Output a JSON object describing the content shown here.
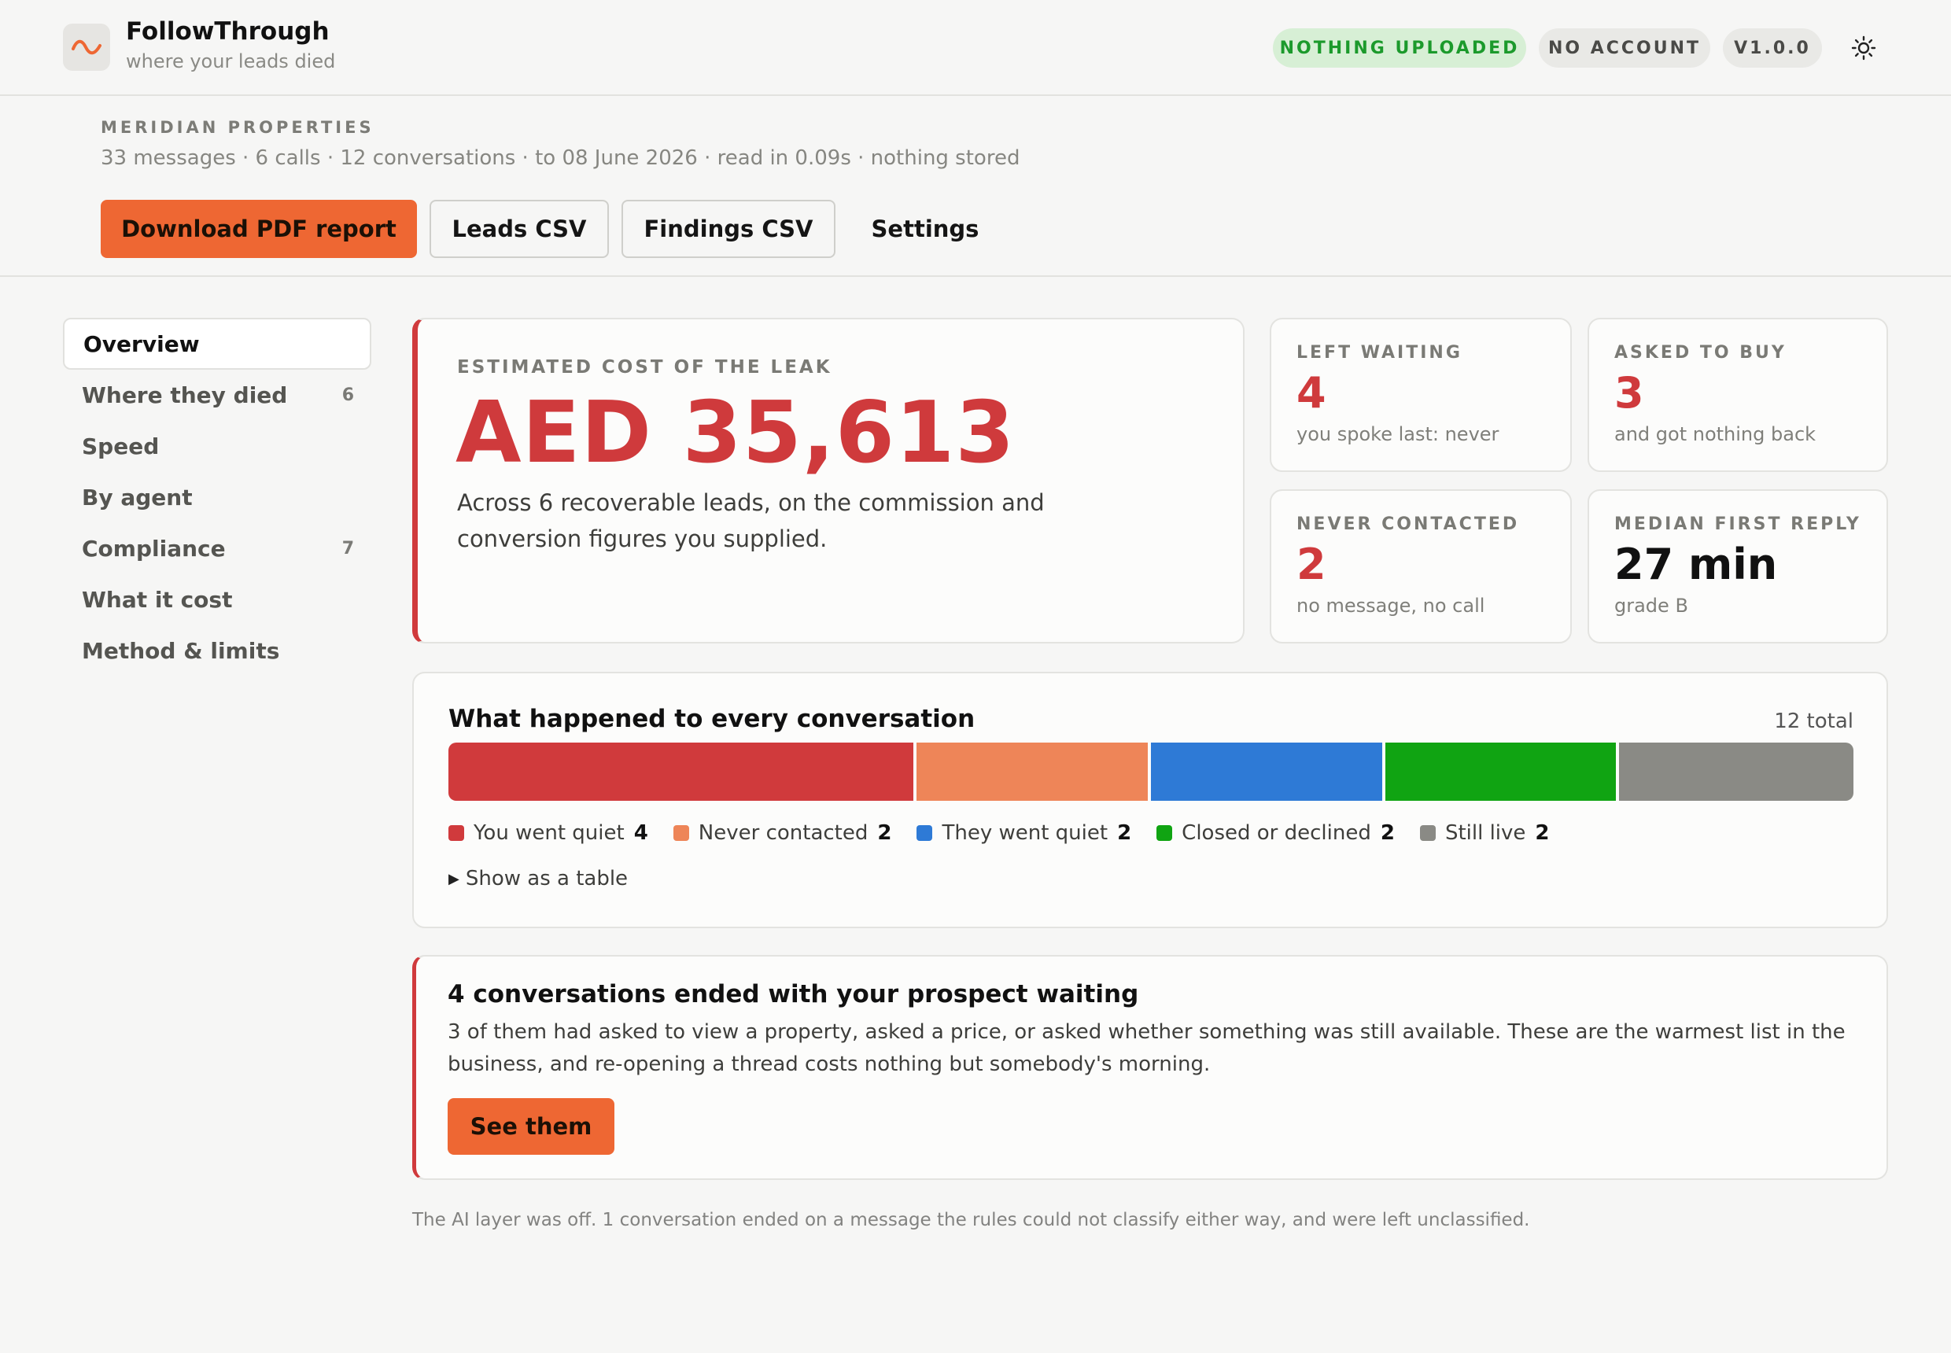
{
  "brand": {
    "name": "FollowThrough",
    "tagline": "where your leads died"
  },
  "status": {
    "upload": "NOTHING UPLOADED",
    "account": "NO ACCOUNT",
    "version": "V1.0.0"
  },
  "report": {
    "company": "MERIDIAN PROPERTIES",
    "meta": "33 messages · 6 calls · 12 conversations · to 08 June 2026 · read in 0.09s · nothing stored"
  },
  "actions": {
    "pdf": "Download PDF report",
    "leads_csv": "Leads CSV",
    "findings_csv": "Findings CSV",
    "settings": "Settings"
  },
  "sidebar": {
    "items": [
      {
        "label": "Overview",
        "count": ""
      },
      {
        "label": "Where they died",
        "count": "6"
      },
      {
        "label": "Speed",
        "count": ""
      },
      {
        "label": "By agent",
        "count": ""
      },
      {
        "label": "Compliance",
        "count": "7"
      },
      {
        "label": "What it cost",
        "count": ""
      },
      {
        "label": "Method & limits",
        "count": ""
      }
    ]
  },
  "hero": {
    "label": "ESTIMATED COST OF THE LEAK",
    "amount": "AED 35,613",
    "description": "Across 6 recoverable leads, on the commission and conversion figures you supplied."
  },
  "stats": [
    {
      "label": "LEFT WAITING",
      "value": "4",
      "sub": "you spoke last: never"
    },
    {
      "label": "ASKED TO BUY",
      "value": "3",
      "sub": "and got nothing back"
    },
    {
      "label": "NEVER CONTACTED",
      "value": "2",
      "sub": "no message, no call"
    },
    {
      "label": "MEDIAN FIRST REPLY",
      "value": "27 min",
      "sub": "grade B"
    }
  ],
  "flow": {
    "title": "What happened to every conversation",
    "total": "12 total",
    "segments": [
      {
        "name": "You went quiet",
        "count": 4,
        "color": "#d03a3c"
      },
      {
        "name": "Never contacted",
        "count": 2,
        "color": "#ee8558"
      },
      {
        "name": "They went quiet",
        "count": 2,
        "color": "#2e7ad6"
      },
      {
        "name": "Closed or declined",
        "count": 2,
        "color": "#10a412"
      },
      {
        "name": "Still live",
        "count": 2,
        "color": "#8a8a85"
      }
    ],
    "toggle": "Show as a table"
  },
  "alert": {
    "title": "4 conversations ended with your prospect waiting",
    "body": "3 of them had asked to view a property, asked a price, or asked whether something was still available. These are the warmest list in the business, and re-opening a thread costs nothing but somebody's morning.",
    "button": "See them"
  },
  "footnote": "The AI layer was off. 1 conversation ended on a message the rules could not classify either way, and were left unclassified.",
  "colors": {
    "accent": "#ee6733",
    "danger": "#cf3a3c",
    "success": "#1c9a2c"
  }
}
